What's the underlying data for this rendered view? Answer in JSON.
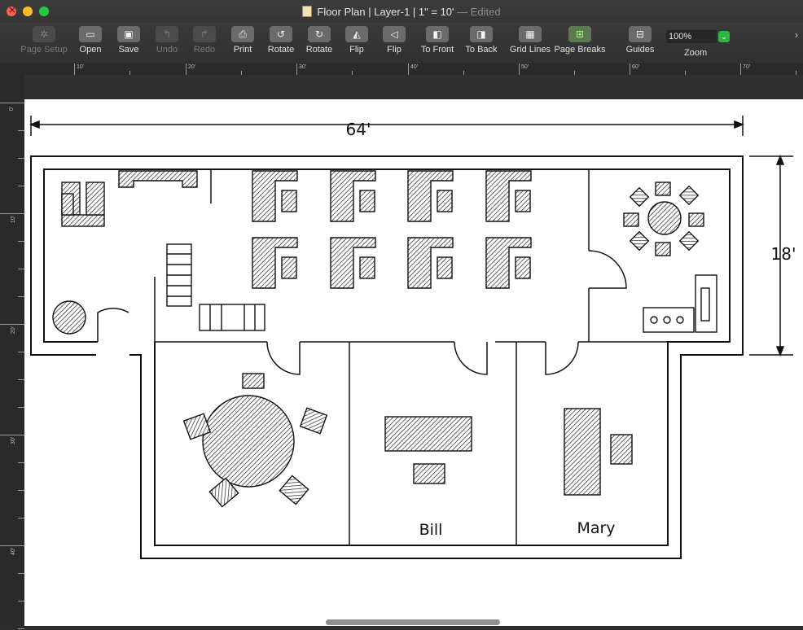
{
  "window": {
    "title": "Floor Plan | Layer-1 | 1\" = 10'",
    "title_suffix": "— Edited"
  },
  "toolbar": {
    "buttons": [
      {
        "label": "Page Setup",
        "icon": "gear-icon",
        "enabled": false
      },
      {
        "label": "Open",
        "icon": "folder-icon",
        "enabled": true
      },
      {
        "label": "Save",
        "icon": "floppy-icon",
        "enabled": true
      },
      {
        "label": "Undo",
        "icon": "undo-arrow-icon",
        "enabled": false
      },
      {
        "label": "Redo",
        "icon": "redo-arrow-icon",
        "enabled": false
      },
      {
        "label": "Print",
        "icon": "printer-icon",
        "enabled": true
      },
      {
        "label": "Rotate",
        "icon": "rotate-left-icon",
        "enabled": true
      },
      {
        "label": "Rotate",
        "icon": "rotate-right-icon",
        "enabled": true
      },
      {
        "label": "Flip",
        "icon": "flip-horizontal-icon",
        "enabled": true
      },
      {
        "label": "Flip",
        "icon": "flip-vertical-icon",
        "enabled": true
      },
      {
        "label": "To Front",
        "icon": "bring-front-icon",
        "enabled": true
      },
      {
        "label": "To Back",
        "icon": "send-back-icon",
        "enabled": true
      },
      {
        "label": "Grid Lines",
        "icon": "grid-lines-icon",
        "enabled": true
      },
      {
        "label": "Page Breaks",
        "icon": "page-breaks-icon",
        "enabled": true
      },
      {
        "label": "Guides",
        "icon": "guides-icon",
        "enabled": true
      }
    ],
    "zoom_value": "100%",
    "zoom_label": "Zoom",
    "overflow_icon": "chevron-right-icon"
  },
  "rulers": {
    "horizontal": [
      "10'",
      "20'",
      "30'",
      "40'",
      "50'",
      "60'",
      "70'"
    ],
    "vertical": [
      "0'",
      "10'",
      "20'",
      "30'",
      "40'"
    ]
  },
  "plan": {
    "width_dimension": "64'",
    "height_dimension": "18'",
    "office_labels": [
      "Bill",
      "Mary"
    ]
  }
}
